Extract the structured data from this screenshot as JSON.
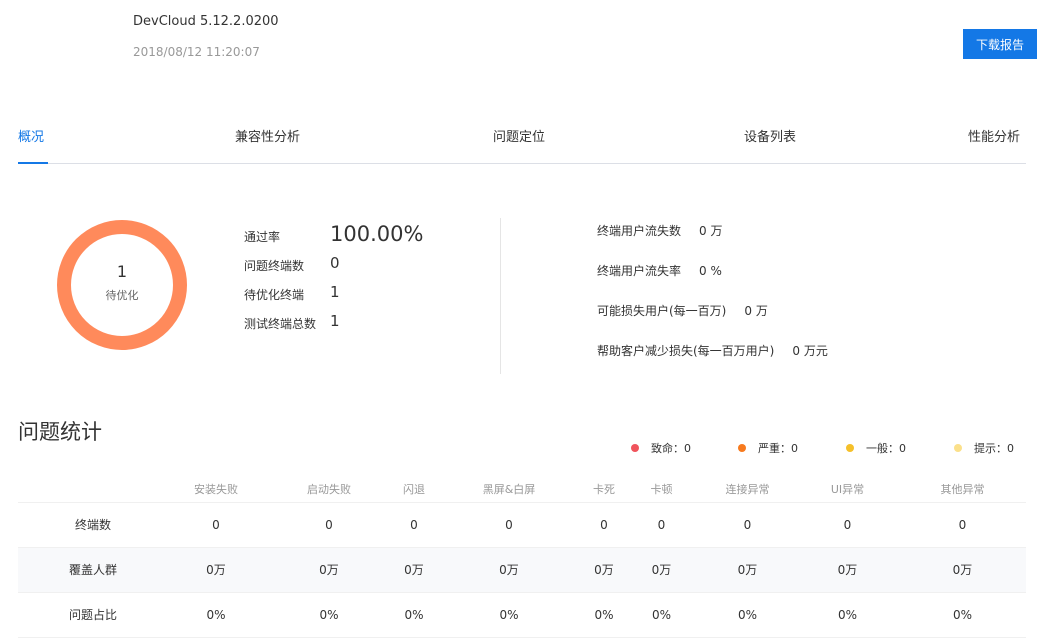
{
  "header": {
    "app_name": "DevCloud 5.12.2.0200",
    "timestamp": "2018/08/12 11:20:07",
    "download_label": "下载报告"
  },
  "tabs": [
    {
      "label": "概况",
      "active": true
    },
    {
      "label": "兼容性分析",
      "active": false
    },
    {
      "label": "问题定位",
      "active": false
    },
    {
      "label": "设备列表",
      "active": false
    },
    {
      "label": "性能分析",
      "active": false
    }
  ],
  "overview": {
    "donut_value": "1",
    "donut_label": "待优化",
    "donut_color": "#ff8a5b",
    "stats": [
      {
        "label": "通过率",
        "value": "100.00%"
      },
      {
        "label": "问题终端数",
        "value": "0"
      },
      {
        "label": "待优化终端",
        "value": "1"
      },
      {
        "label": "测试终端总数",
        "value": "1"
      }
    ],
    "metrics": [
      {
        "label": "终端用户流失数",
        "value": "0 万"
      },
      {
        "label": "终端用户流失率",
        "value": "0 %"
      },
      {
        "label": "可能损失用户(每一百万)",
        "value": "0 万"
      },
      {
        "label": "帮助客户减少损失(每一百万用户)",
        "value": "0 万元"
      }
    ]
  },
  "issues": {
    "title": "问题统计",
    "legend": [
      {
        "label": "致命：0",
        "color": "#f0545c"
      },
      {
        "label": "严重：0",
        "color": "#f77a1e"
      },
      {
        "label": "一般：0",
        "color": "#f5c02a"
      },
      {
        "label": "提示：0",
        "color": "#fbe08a"
      }
    ],
    "columns": [
      "",
      "安装失败",
      "启动失败",
      "闪退",
      "黑屏&白屏",
      "卡死",
      "卡顿",
      "连接异常",
      "UI异常",
      "其他异常"
    ],
    "rows": [
      {
        "label": "终端数",
        "cells": [
          "0",
          "0",
          "0",
          "0",
          "0",
          "0",
          "0",
          "0",
          "0"
        ]
      },
      {
        "label": "覆盖人群",
        "cells": [
          "0万",
          "0万",
          "0万",
          "0万",
          "0万",
          "0万",
          "0万",
          "0万",
          "0万"
        ]
      },
      {
        "label": "问题占比",
        "cells": [
          "0%",
          "0%",
          "0%",
          "0%",
          "0%",
          "0%",
          "0%",
          "0%",
          "0%"
        ]
      }
    ]
  }
}
